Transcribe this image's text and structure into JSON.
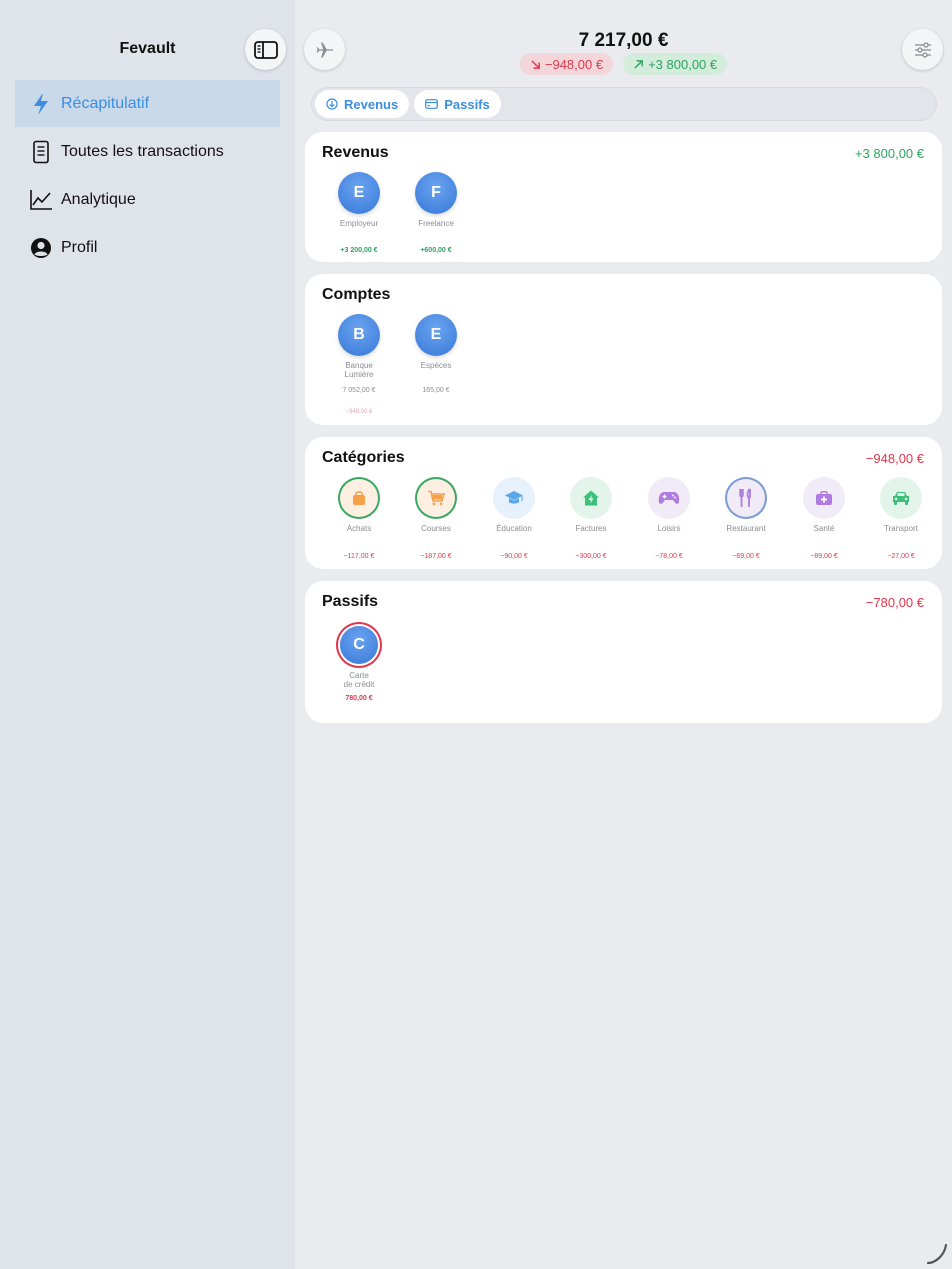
{
  "sidebar": {
    "title": "Fevault",
    "toggle_icon": "sidebar-toggle-icon",
    "items": [
      {
        "label": "Récapitulatif",
        "icon": "bolt-icon",
        "active": true
      },
      {
        "label": "Toutes les transactions",
        "icon": "receipt-icon",
        "active": false
      },
      {
        "label": "Analytique",
        "icon": "chart-line-icon",
        "active": false
      },
      {
        "label": "Profil",
        "icon": "person-circle-icon",
        "active": false
      }
    ]
  },
  "header": {
    "balance": "7 217,00 €",
    "expense_badge": "−948,00 €",
    "income_badge": "+3 800,00 €"
  },
  "tabs": [
    {
      "label": "Revenus",
      "icon": "arrow-down-circle-icon"
    },
    {
      "label": "Passifs",
      "icon": "credit-card-icon"
    }
  ],
  "revenus": {
    "title": "Revenus",
    "total": "+3 800,00 €",
    "items": [
      {
        "letter": "E",
        "name": "Employeur",
        "amount": "+3 200,00 €"
      },
      {
        "letter": "F",
        "name": "Freelance",
        "amount": "+600,00 €"
      }
    ]
  },
  "comptes": {
    "title": "Comptes",
    "items": [
      {
        "letter": "B",
        "name_line1": "Banque",
        "name_line2": "Lumière",
        "amount": "7 052,00 €",
        "sub_amount": "−948,00 €"
      },
      {
        "letter": "E",
        "name_line1": "Espèces",
        "name_line2": "",
        "amount": "165,00 €",
        "sub_amount": ""
      }
    ]
  },
  "categories": {
    "title": "Catégories",
    "total": "−948,00 €",
    "items": [
      {
        "name": "Achats",
        "amount": "−117,00 €",
        "icon": "shopping-bag-icon",
        "color": "#f5a04a"
      },
      {
        "name": "Courses",
        "amount": "−187,00 €",
        "icon": "cart-icon",
        "color": "#f5a04a"
      },
      {
        "name": "Éducation",
        "amount": "−90,00 €",
        "icon": "graduation-cap-icon",
        "color": "#5aa8e8"
      },
      {
        "name": "Factures",
        "amount": "−300,00 €",
        "icon": "house-bolt-icon",
        "color": "#3cc07a"
      },
      {
        "name": "Loisirs",
        "amount": "−78,00 €",
        "icon": "gamepad-icon",
        "color": "#b07be0"
      },
      {
        "name": "Restaurant",
        "amount": "−69,00 €",
        "icon": "fork-knife-icon",
        "color": "#b07be0"
      },
      {
        "name": "Santé",
        "amount": "−89,00 €",
        "icon": "medical-bag-icon",
        "color": "#b07be0"
      },
      {
        "name": "Transport",
        "amount": "−27,00 €",
        "icon": "car-icon",
        "color": "#3cc07a"
      }
    ]
  },
  "passifs": {
    "title": "Passifs",
    "total": "−780,00 €",
    "items": [
      {
        "letter": "C",
        "name_line1": "Carte",
        "name_line2": "de crédit",
        "amount": "780,00 €"
      }
    ]
  }
}
